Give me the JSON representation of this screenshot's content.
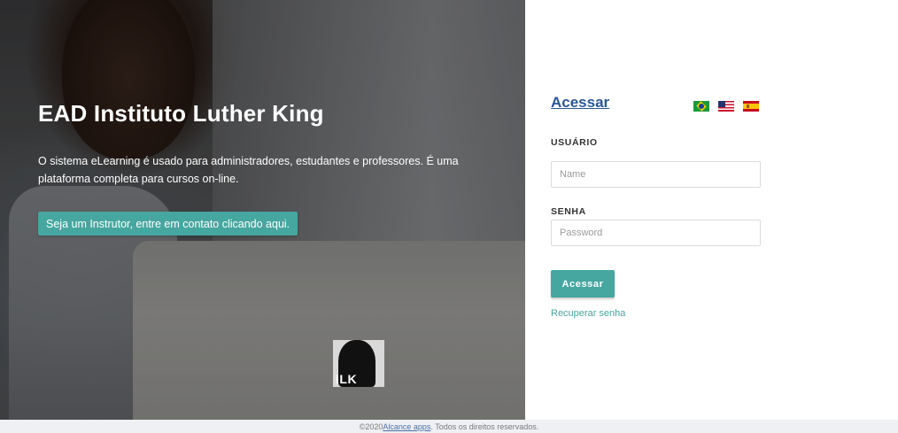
{
  "hero": {
    "title": "EAD Instituto Luther King",
    "description": "O sistema eLearning é usado para administradores, estudantes e professores. É uma plataforma completa para cursos on-line.",
    "instructor_button": "Seja um Instrutor, entre em contato clicando aqui.",
    "logo_text": "ILK"
  },
  "login": {
    "title": "Acessar",
    "languages": [
      "pt-BR",
      "en-US",
      "es-ES"
    ],
    "user_label": "USUÁRIO",
    "user_placeholder": "Name",
    "user_value": "",
    "password_label": "SENHA",
    "password_placeholder": "Password",
    "password_value": "",
    "submit_label": "Acessar",
    "recover_link": "Recuperar senha"
  },
  "footer": {
    "prefix": "©2020 ",
    "link": "Alcance apps",
    "suffix": ". Todos os direitos reservados."
  },
  "colors": {
    "accent": "#46a6a0",
    "link": "#2b5797",
    "footer_bg": "#eef0f3"
  }
}
